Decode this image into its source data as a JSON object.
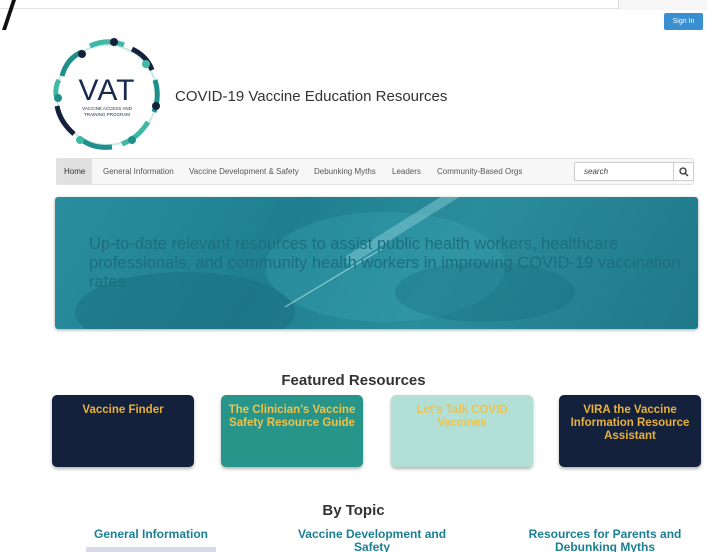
{
  "site": {
    "title": "COVID-19 Vaccine Education Resources",
    "logo_text": "VAT",
    "logo_subtitle_1": "VACCINE ACCESS AND",
    "logo_subtitle_2": "TRAINING PROGRAM"
  },
  "header": {
    "signin_label": "Sign In"
  },
  "nav": {
    "items": [
      "Home",
      "General Information",
      "Vaccine Development & Safety",
      "Debunking Myths",
      "Leaders",
      "Community-Based Orgs"
    ],
    "search_placeholder": "search"
  },
  "hero": {
    "text": "Up-to-date relevant resources to assist public health workers, healthcare professionals, and community health workers in improving COVID-19 vaccination rates."
  },
  "featured": {
    "title": "Featured Resources",
    "cards": [
      {
        "label": "Vaccine Finder"
      },
      {
        "label": "The Clinician's Vaccine Safety Resource Guide"
      },
      {
        "label": "Let's Talk COVID Vaccines"
      },
      {
        "label": "VIRA the Vaccine Information Resource Assistant"
      }
    ]
  },
  "topics": {
    "title": "By Topic",
    "items": [
      {
        "label": "General Information"
      },
      {
        "label": "Vaccine Development and Safety"
      },
      {
        "label": "Resources for Parents and Debunking Myths"
      }
    ]
  },
  "colors": {
    "navy": "#14213d",
    "teal": "#27958a",
    "mint": "#b3e0d6",
    "gold": "#e8b13a",
    "topic_blue": "#1b7f93",
    "signin_blue": "#3a8fd0"
  },
  "icons": {
    "search": "magnifier-icon",
    "logo": "vat-wreath-logo"
  }
}
